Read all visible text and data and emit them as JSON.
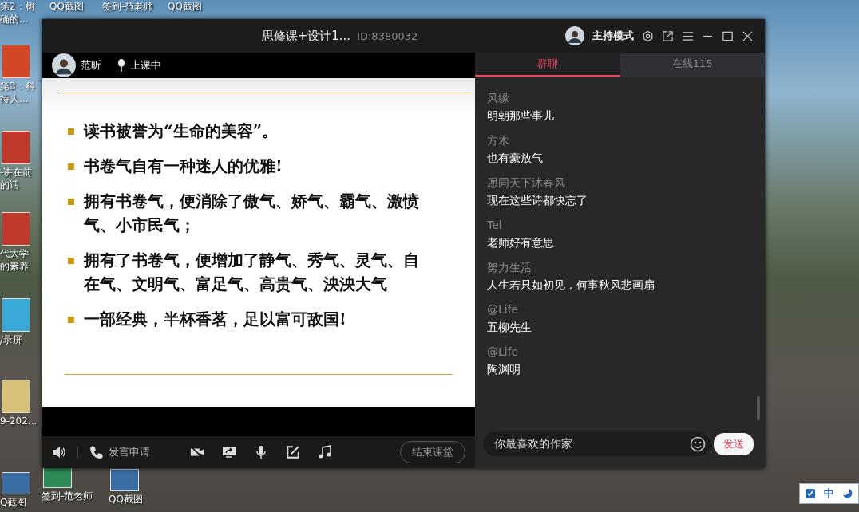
{
  "desktop": {
    "icons": [
      {
        "lines": [
          "第2：树",
          "确的..."
        ]
      },
      {
        "lines": [
          "QQ截图"
        ]
      },
      {
        "lines": [
          "签到-范老师"
        ]
      },
      {
        "lines": [
          "QQ截图"
        ]
      },
      {
        "lines": [
          "第3：科",
          "待人..."
        ],
        "kind": "ppt"
      },
      {
        "lines": [
          "-讲在前",
          "的话"
        ],
        "kind": "doc"
      },
      {
        "lines": [
          "代大学",
          "的素养"
        ],
        "kind": "doc"
      },
      {
        "lines": [
          "/录屏"
        ],
        "kind": "app"
      },
      {
        "lines": [
          "9-202..."
        ],
        "kind": "folder"
      },
      {
        "lines": [
          "Q截图"
        ],
        "kind": "image"
      },
      {
        "lines": [
          "签到-范老师"
        ],
        "kind": "sheet"
      },
      {
        "lines": [
          "QQ截图"
        ],
        "kind": "image"
      }
    ],
    "ime": "中"
  },
  "window": {
    "title": "思修课+设计1...",
    "id_label": "ID:8380032",
    "mode": "主持模式"
  },
  "presenter": {
    "name": "范昕",
    "status": "上课中"
  },
  "slide": {
    "bullets": [
      "读书被誉为“生命的美容”。",
      "书卷气自有一种迷人的优雅!",
      "拥有书卷气，便消除了傲气、娇气、霸气、激愤气、小市民气；",
      "拥有了书卷气，便增加了静气、秀气、灵气、自在气、文明气、富足气、高贵气、泱泱大气",
      "一部经典，半杯香茗，足以富可敌国!"
    ]
  },
  "toolbar": {
    "request": "发言申请",
    "end": "结束课堂"
  },
  "tabs": [
    {
      "label": "群聊",
      "selected": true
    },
    {
      "label": "在线115",
      "selected": false
    }
  ],
  "messages": [
    {
      "sender": "风缘",
      "text": "明朝那些事儿"
    },
    {
      "sender": "方木",
      "text": "也有豪放气"
    },
    {
      "sender": "愿同天下沐春风",
      "text": "现在这些诗都快忘了"
    },
    {
      "sender": "Tel",
      "text": "老师好有意思"
    },
    {
      "sender": "努力生活",
      "text": "人生若只如初见，何事秋风悲画扇"
    },
    {
      "sender": "@Life",
      "text": "五柳先生"
    },
    {
      "sender": "@Life",
      "text": "陶渊明"
    }
  ],
  "input": {
    "value": "你最喜欢的作家"
  },
  "send": "发送"
}
